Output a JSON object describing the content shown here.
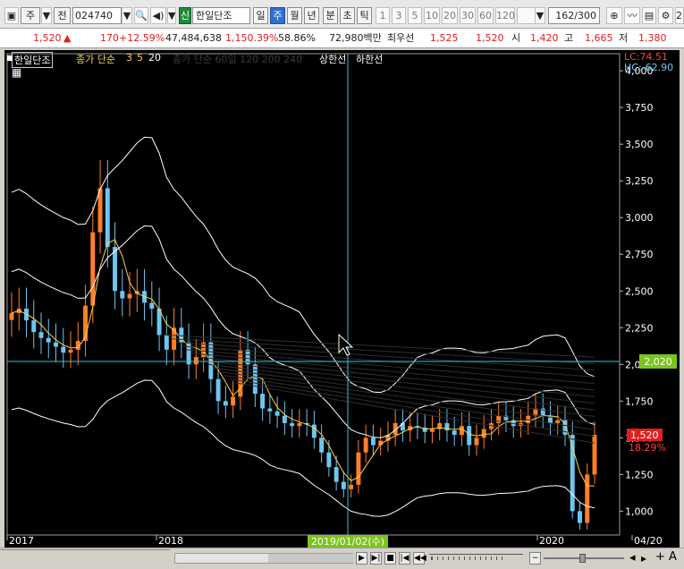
{
  "toolbar": {
    "market_label": "주",
    "prev_label": "전",
    "code_value": "024740",
    "badge_label": "신",
    "stock_name": "한일단조",
    "period_tabs": [
      "일",
      "주",
      "월",
      "년"
    ],
    "minute_tabs": [
      "분",
      "초",
      "틱"
    ],
    "interval_tabs": [
      "1",
      "3",
      "5",
      "10",
      "20",
      "30",
      "60",
      "120"
    ],
    "page_counter": "162/300",
    "trailing_text": "2"
  },
  "quote": {
    "price": "1,520",
    "change": "170",
    "change_pct": "+12.59%",
    "volume": "47,484,638",
    "volume_ratio": "1,150.39%",
    "turnover_ratio": "58.86%",
    "amount": "72,980백만",
    "best_label": "최우선",
    "best_ask": "1,525",
    "best_bid": "1,520",
    "open_label": "시",
    "open": "1,420",
    "high_label": "고",
    "high": "1,665",
    "low_label": "저",
    "low": "1,380"
  },
  "legend": {
    "name": "한일단조",
    "ma_label": "종가 단순",
    "ma_periods": [
      "3",
      "5",
      "20"
    ],
    "dim_text": "종가 단순 60일 120 200 240",
    "upper_limit": "상한선",
    "lower_limit": "하한선"
  },
  "axis": {
    "lc_label": "LC:74.51",
    "hc_label": "HC:-62.90",
    "crosshair_price": "2,020",
    "current_price": "1,520",
    "current_pct": "18.29%",
    "crosshair_date": "2019/01/02(수)",
    "y_ticks": [
      "4,000",
      "3,750",
      "3,500",
      "3,250",
      "3,000",
      "2,750",
      "2,500",
      "2,250",
      "2,000",
      "1,750",
      "1,500",
      "1,250",
      "1,000"
    ],
    "x_ticks": [
      "2017",
      "2018",
      "2020",
      "04/20"
    ]
  },
  "chart_data": {
    "type": "candlestick",
    "period": "weekly",
    "x_start": "2017",
    "x_end": "2020-04",
    "ylim": [
      850,
      4080
    ],
    "closes": [
      2350,
      2380,
      2300,
      2220,
      2180,
      2150,
      2120,
      2080,
      2100,
      2160,
      2400,
      2900,
      3200,
      2800,
      2500,
      2450,
      2480,
      2500,
      2420,
      2380,
      2200,
      2100,
      2250,
      2150,
      2000,
      2050,
      2150,
      1900,
      1750,
      1720,
      1780,
      2100,
      2000,
      1800,
      1700,
      1680,
      1650,
      1600,
      1580,
      1600,
      1590,
      1500,
      1400,
      1300,
      1200,
      1150,
      1180,
      1400,
      1500,
      1450,
      1480,
      1520,
      1600,
      1550,
      1580,
      1570,
      1540,
      1560,
      1600,
      1550,
      1520,
      1580,
      1450,
      1500,
      1560,
      1600,
      1650,
      1620,
      1580,
      1600,
      1650,
      1700,
      1650,
      1600,
      1620,
      1520,
      1000,
      920,
      1250,
      1520
    ],
    "current": 1520,
    "crosshair_value": 2020,
    "colors": {
      "up": "#ff7f27",
      "down": "#6ec6f0",
      "ma": "#ffd24a",
      "band": "#ffffff",
      "crosshair": "#29c7d6"
    }
  }
}
